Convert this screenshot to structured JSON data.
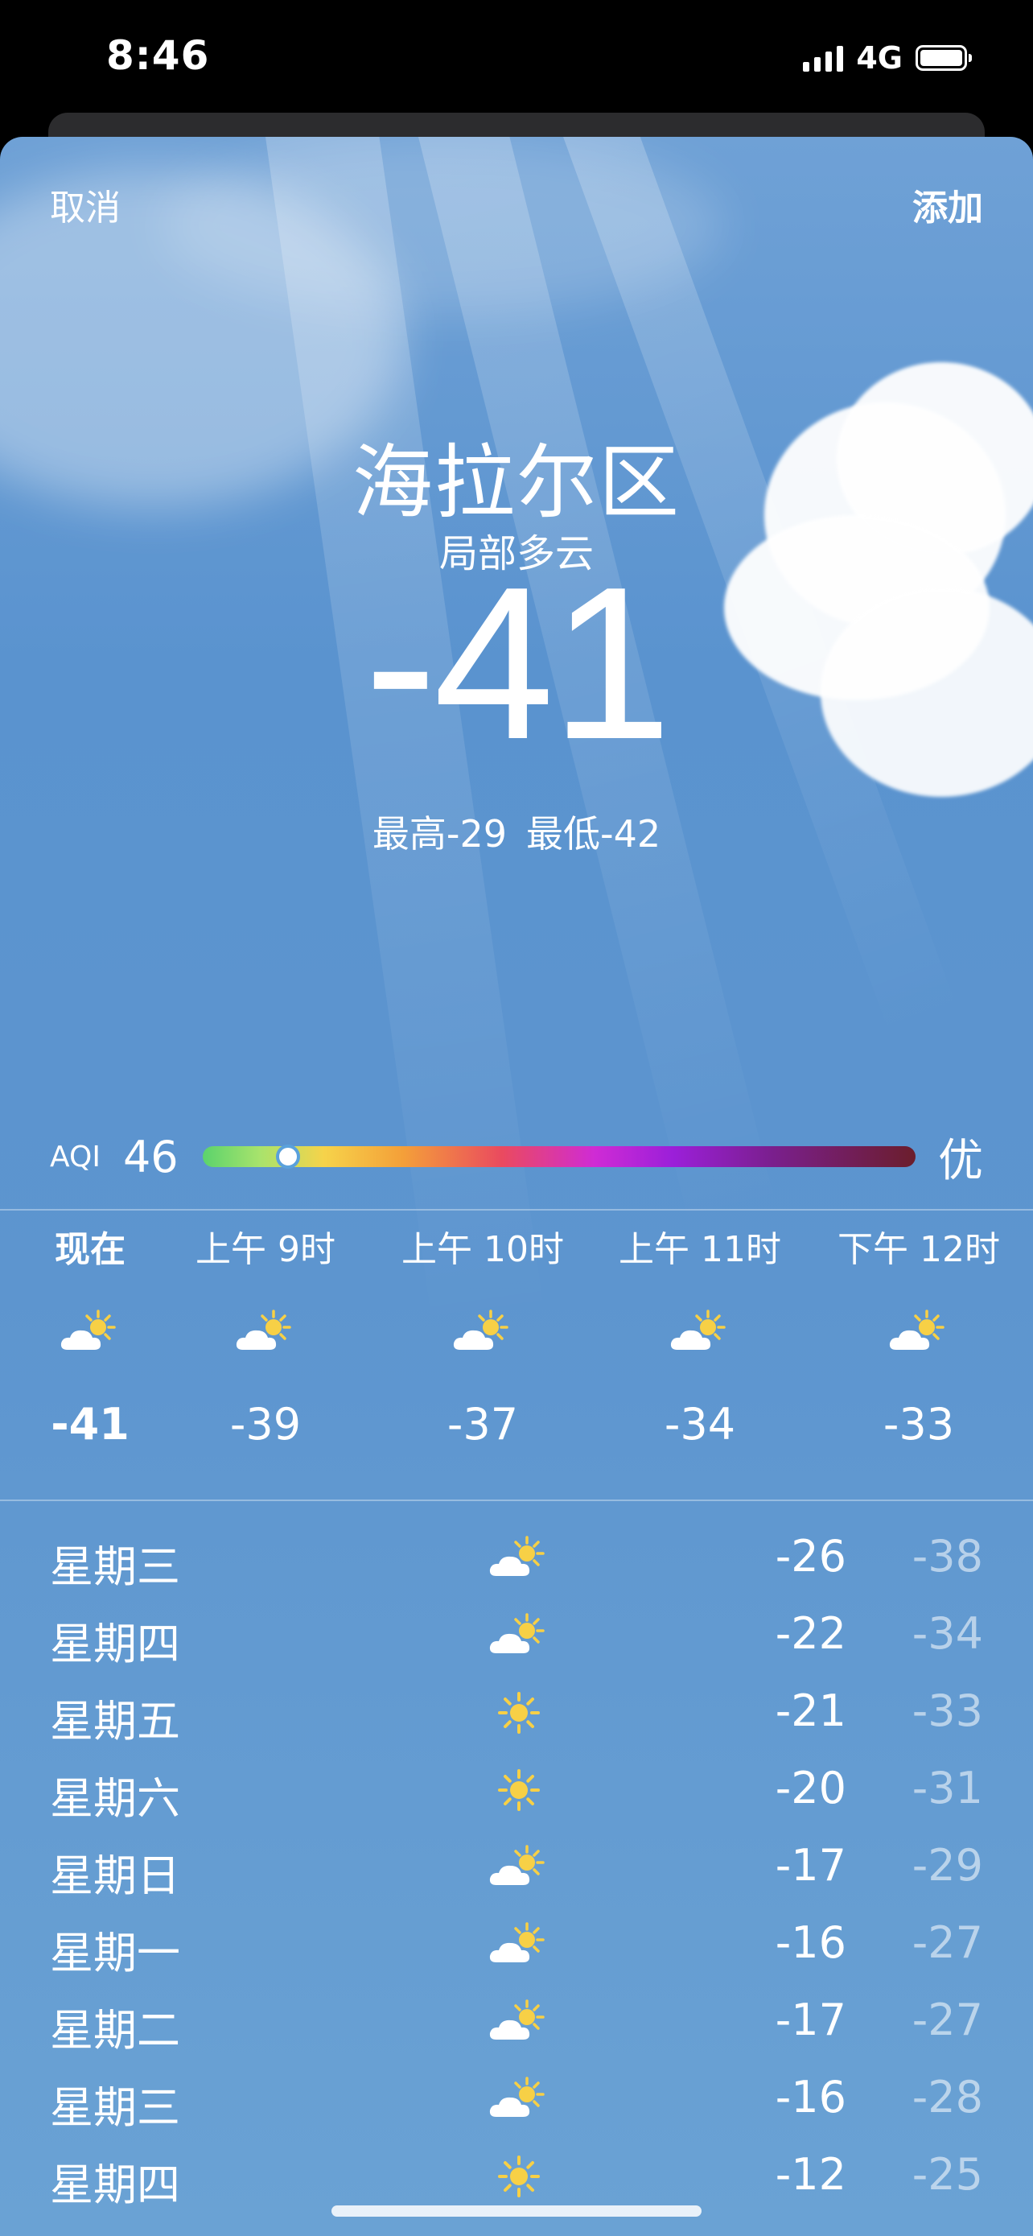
{
  "status_bar": {
    "time": "8:46",
    "network": "4G",
    "signal_bars": 4,
    "battery_level": 1.0
  },
  "nav": {
    "cancel_label": "取消",
    "add_label": "添加"
  },
  "location": {
    "city": "海拉尔区",
    "condition": "局部多云",
    "temperature": "-41",
    "high": "最高-29",
    "low": "最低-42"
  },
  "aqi": {
    "label": "AQI",
    "value": "46",
    "position": 0.12,
    "grade": "优"
  },
  "hourly": [
    {
      "time": "现在",
      "icon": "partly-cloudy-icon",
      "temp": "-41",
      "current": true
    },
    {
      "time": "上午 9时",
      "icon": "partly-cloudy-icon",
      "temp": "-39"
    },
    {
      "time": "上午 10时",
      "icon": "partly-cloudy-icon",
      "temp": "-37"
    },
    {
      "time": "上午 11时",
      "icon": "partly-cloudy-icon",
      "temp": "-34"
    },
    {
      "time": "下午 12时",
      "icon": "partly-cloudy-icon",
      "temp": "-33"
    }
  ],
  "daily": [
    {
      "day": "星期三",
      "icon": "partly-cloudy-icon",
      "high": "-26",
      "low": "-38"
    },
    {
      "day": "星期四",
      "icon": "partly-cloudy-icon",
      "high": "-22",
      "low": "-34"
    },
    {
      "day": "星期五",
      "icon": "sun-icon",
      "high": "-21",
      "low": "-33"
    },
    {
      "day": "星期六",
      "icon": "sun-icon",
      "high": "-20",
      "low": "-31"
    },
    {
      "day": "星期日",
      "icon": "partly-cloudy-icon",
      "high": "-17",
      "low": "-29"
    },
    {
      "day": "星期一",
      "icon": "partly-cloudy-icon",
      "high": "-16",
      "low": "-27"
    },
    {
      "day": "星期二",
      "icon": "partly-cloudy-icon",
      "high": "-17",
      "low": "-27"
    },
    {
      "day": "星期三",
      "icon": "partly-cloudy-icon",
      "high": "-16",
      "low": "-28"
    },
    {
      "day": "星期四",
      "icon": "sun-icon",
      "high": "-12",
      "low": "-25"
    }
  ],
  "colors": {
    "sky_top": "#6fa1d6",
    "sky_mid": "#5a93cf",
    "sun": "#f7d046"
  }
}
